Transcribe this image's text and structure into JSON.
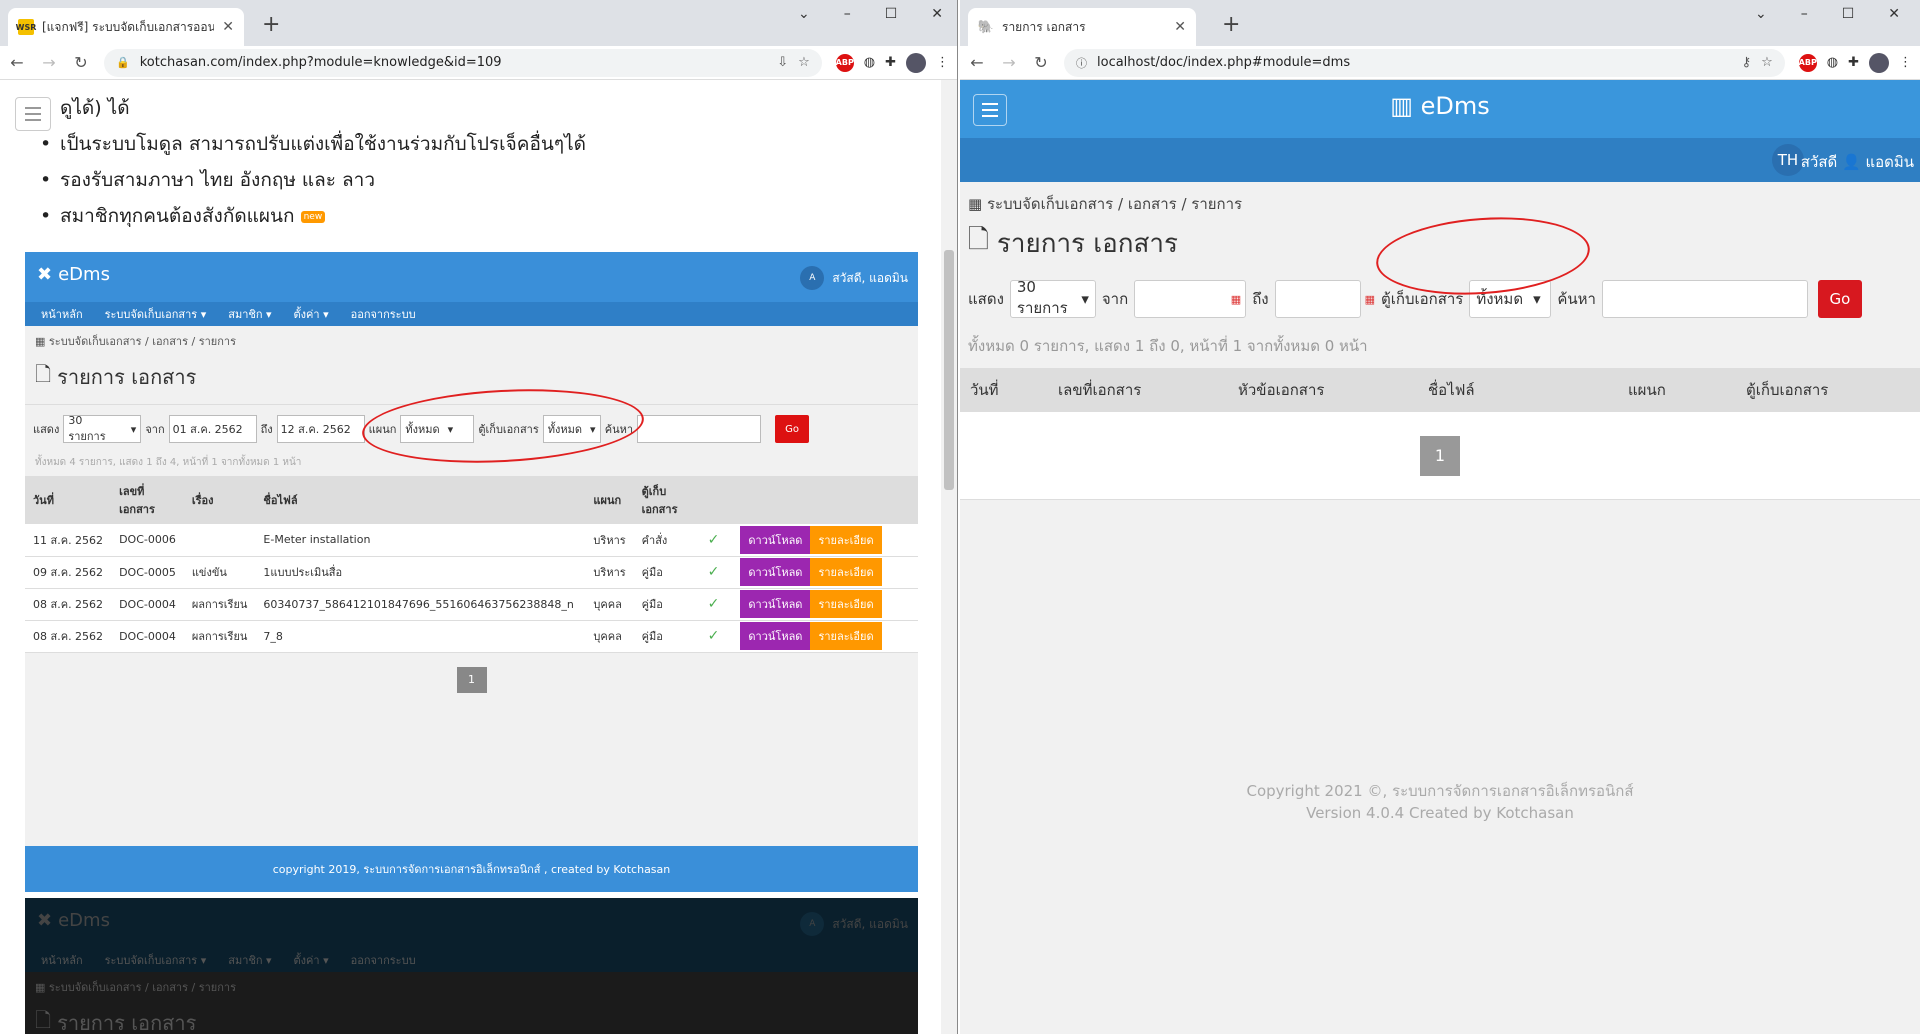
{
  "left_window": {
    "tab_title": "[แจกฟรี] ระบบจัดเก็บเอกสารออนไลน์ F",
    "tab_favicon_text": "WSR",
    "url": "kotchasan.com/index.php?module=knowledge&id=109",
    "page": {
      "bullet_cutoff": "ดูได้) ได้",
      "bullets": [
        "เป็นระบบโมดูล สามารถปรับแต่งเพื่อใช้งานร่วมกับโปรเจ็คอื่นๆได้",
        "รองรับสามภาษา ไทย อังกฤษ และ ลาว",
        "สมาชิกทุกคนต้องสังกัดแผนก"
      ],
      "new_badge": "new",
      "shot": {
        "brand": "eDms",
        "lang": "A",
        "greeting": "สวัสดี, แอดมิน",
        "nav": [
          "หน้าหลัก",
          "ระบบจัดเก็บเอกสาร ▾",
          "สมาชิก ▾",
          "ตั้งค่า ▾",
          "ออกจากระบบ"
        ],
        "crumb": "ระบบจัดเก็บเอกสาร / เอกสาร / รายการ",
        "title": "รายการ เอกสาร",
        "filter": {
          "show_label": "แสดง",
          "show_value": "30 รายการ",
          "from_label": "จาก",
          "from_value": "01 ส.ค. 2562",
          "to_label": "ถึง",
          "to_value": "12 ส.ค. 2562",
          "dept_label": "แผนก",
          "dept_value": "ทั้งหมด",
          "cab_label": "ตู้เก็บเอกสาร",
          "cab_value": "ทั้งหมด",
          "search_label": "ค้นหา",
          "go": "Go"
        },
        "summary": "ทั้งหมด 4 รายการ, แสดง 1 ถึง 4, หน้าที่ 1 จากทั้งหมด 1 หน้า",
        "headers": [
          "วันที่",
          "เลขที่เอกสาร",
          "เรื่อง",
          "ชื่อไฟล์",
          "แผนก",
          "ตู้เก็บเอกสาร"
        ],
        "rows": [
          {
            "date": "11 ส.ค. 2562",
            "no": "DOC-0006",
            "topic": "",
            "file": "E-Meter installation",
            "dept": "บริหาร",
            "cab": "คำสั่ง"
          },
          {
            "date": "09 ส.ค. 2562",
            "no": "DOC-0005",
            "topic": "แข่งขัน",
            "file": "1แบบประเมินสื่อ",
            "dept": "บริหาร",
            "cab": "คู่มือ"
          },
          {
            "date": "08 ส.ค. 2562",
            "no": "DOC-0004",
            "topic": "ผลการเรียน",
            "file": "60340737_586412101847696_551606463756238848_n",
            "dept": "บุคคล",
            "cab": "คู่มือ"
          },
          {
            "date": "08 ส.ค. 2562",
            "no": "DOC-0004",
            "topic": "ผลการเรียน",
            "file": "7_8",
            "dept": "บุคคล",
            "cab": "คู่มือ"
          }
        ],
        "download_label": "ดาวน์โหลด",
        "detail_label": "รายละเอียด",
        "page": "1",
        "footer": "copyright 2019, ระบบการจัดการเอกสารอิเล็กทรอนิกส์ , created by Kotchasan"
      },
      "shot2": {
        "brand": "eDms",
        "lang": "A",
        "greeting": "สวัสดี, แอดมิน",
        "nav": [
          "หน้าหลัก",
          "ระบบจัดเก็บเอกสาร ▾",
          "สมาชิก ▾",
          "ตั้งค่า ▾",
          "ออกจากระบบ"
        ],
        "crumb": "ระบบจัดเก็บเอกสาร / เอกสาร / รายการ",
        "title": "รายการ เอกสาร"
      }
    }
  },
  "right_window": {
    "tab_title": "รายการ เอกสาร",
    "url": "localhost/doc/index.php#module=dms",
    "page": {
      "brand": "eDms",
      "lang": "TH",
      "greeting": "สวัสดี 👤 แอดมิน",
      "crumb": "ระบบจัดเก็บเอกสาร / เอกสาร / รายการ",
      "title": "รายการ เอกสาร",
      "filter": {
        "show_label": "แสดง",
        "show_value": "30 รายการ",
        "from_label": "จาก",
        "to_label": "ถึง",
        "cab_label": "ตู้เก็บเอกสาร",
        "cab_value": "ทั้งหมด",
        "search_label": "ค้นหา",
        "go": "Go"
      },
      "summary": "ทั้งหมด 0 รายการ, แสดง 1 ถึง 0, หน้าที่ 1 จากทั้งหมด 0 หน้า",
      "headers": [
        "วันที่",
        "เลขที่เอกสาร",
        "หัวข้อเอกสาร",
        "ชื่อไฟล์",
        "แผนก",
        "ตู้เก็บเอกสาร"
      ],
      "page": "1",
      "footer_line1": "Copyright 2021 ©, ระบบการจัดการเอกสารอิเล็กทรอนิกส์",
      "footer_line2": "Version 4.0.4 Created by Kotchasan"
    }
  },
  "colors": {
    "header_blue": "#3a96dc",
    "subheader_blue": "#2f7fc3",
    "go_red": "#d7181f",
    "annotation_red": "#e02020",
    "download_purple": "#9c27b0",
    "detail_orange": "#ff9800"
  }
}
